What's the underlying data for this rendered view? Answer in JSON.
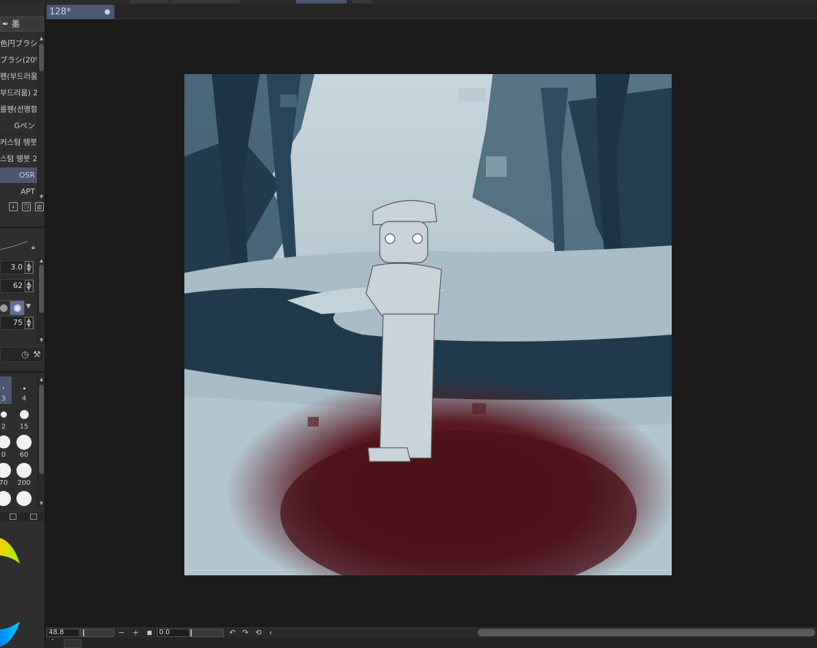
{
  "document": {
    "tab_title": "128*",
    "tab_modified": "●"
  },
  "left_panel": {
    "header_label": "墨",
    "brushes": [
      {
        "label": "色円ブラシ",
        "selected": false
      },
      {
        "label": "ブラシ(20%)",
        "selected": false
      },
      {
        "label": "펜(부드러움)",
        "selected": false
      },
      {
        "label": "부드러움) 2",
        "selected": false
      },
      {
        "label": "를펜(선명함)",
        "selected": false
      },
      {
        "label": "Gペン",
        "selected": false
      },
      {
        "label": "커스텀 뗑붓",
        "selected": false
      },
      {
        "label": "스텀 뗑붓 2",
        "selected": false
      },
      {
        "label": "OSR",
        "selected": true
      },
      {
        "label": "APT",
        "selected": false
      }
    ],
    "properties": {
      "size_value": "3.0",
      "opacity_value": "62",
      "density_value": "75"
    },
    "brush_sizes": [
      {
        "label": "3",
        "selected": true
      },
      {
        "label": "4",
        "selected": false
      },
      {
        "label": "2",
        "selected": false
      },
      {
        "label": "15",
        "selected": false
      },
      {
        "label": "0",
        "selected": false
      },
      {
        "label": "60",
        "selected": false
      },
      {
        "label": "70",
        "selected": false
      },
      {
        "label": "200",
        "selected": false
      },
      {
        "label": "",
        "selected": false
      },
      {
        "label": "",
        "selected": false
      }
    ]
  },
  "status": {
    "zoom": "48.8",
    "zoom_minus": "−",
    "zoom_plus": "+",
    "rotation": "0.0"
  },
  "icons": {
    "undo": "undo-icon",
    "redo": "redo-icon",
    "reset": "reset-icon",
    "collapse": "chevron-left-icon"
  }
}
